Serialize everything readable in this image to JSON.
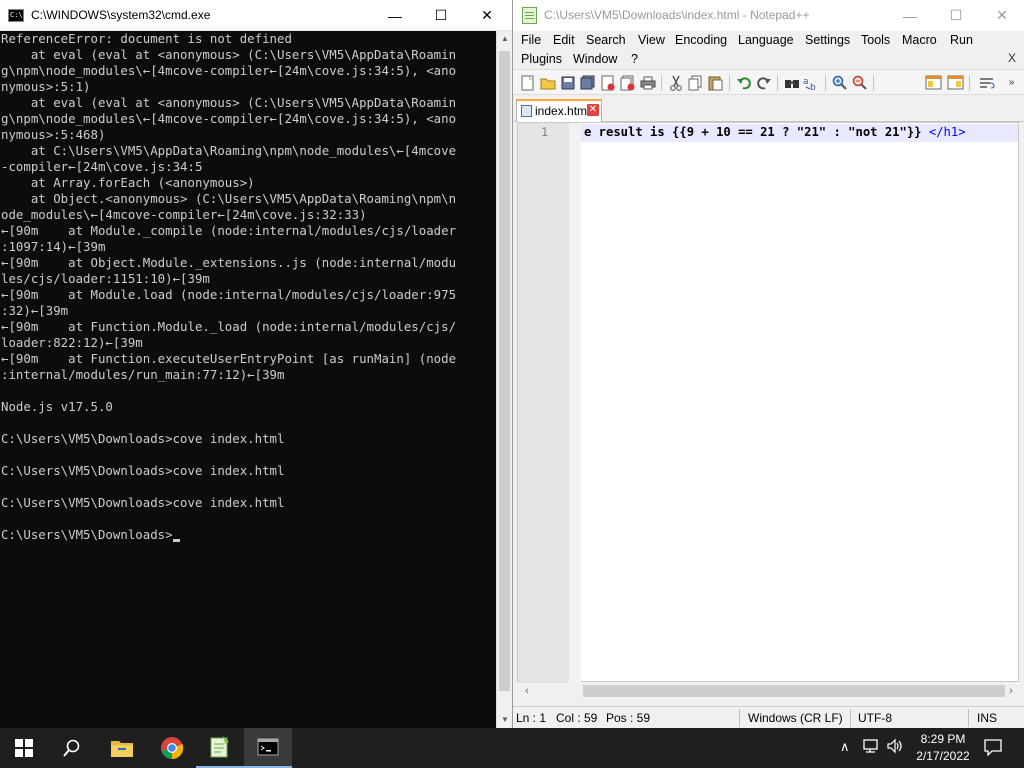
{
  "cmd": {
    "title": "C:\\WINDOWS\\system32\\cmd.exe",
    "icon_text": "C:\\",
    "buttons": {
      "minimize": "—",
      "maximize": "☐",
      "close": "✕"
    },
    "lines": [
      "ReferenceError: document is not defined",
      "    at eval (eval at <anonymous> (C:\\Users\\VM5\\AppData\\Roamin",
      "g\\npm\\node_modules\\←[4mcove-compiler←[24m\\cove.js:34:5), <ano",
      "nymous>:5:1)",
      "    at eval (eval at <anonymous> (C:\\Users\\VM5\\AppData\\Roamin",
      "g\\npm\\node_modules\\←[4mcove-compiler←[24m\\cove.js:34:5), <ano",
      "nymous>:5:468)",
      "    at C:\\Users\\VM5\\AppData\\Roaming\\npm\\node_modules\\←[4mcove",
      "-compiler←[24m\\cove.js:34:5",
      "    at Array.forEach (<anonymous>)",
      "    at Object.<anonymous> (C:\\Users\\VM5\\AppData\\Roaming\\npm\\n",
      "ode_modules\\←[4mcove-compiler←[24m\\cove.js:32:33)",
      "←[90m    at Module._compile (node:internal/modules/cjs/loader",
      ":1097:14)←[39m",
      "←[90m    at Object.Module._extensions..js (node:internal/modu",
      "les/cjs/loader:1151:10)←[39m",
      "←[90m    at Module.load (node:internal/modules/cjs/loader:975",
      ":32)←[39m",
      "←[90m    at Function.Module._load (node:internal/modules/cjs/",
      "loader:822:12)←[39m",
      "←[90m    at Function.executeUserEntryPoint [as runMain] (node",
      ":internal/modules/run_main:77:12)←[39m",
      "",
      "Node.js v17.5.0",
      "",
      "C:\\Users\\VM5\\Downloads>cove index.html",
      "",
      "C:\\Users\\VM5\\Downloads>cove index.html",
      "",
      "C:\\Users\\VM5\\Downloads>cove index.html",
      "",
      "C:\\Users\\VM5\\Downloads>"
    ]
  },
  "npp": {
    "title": "C:\\Users\\VM5\\Downloads\\index.html - Notepad++",
    "menu": {
      "file": "File",
      "edit": "Edit",
      "search": "Search",
      "view": "View",
      "encoding": "Encoding",
      "language": "Language",
      "settings": "Settings",
      "tools": "Tools",
      "macro": "Macro",
      "run": "Run",
      "plugins": "Plugins",
      "window": "Window",
      "help": "?",
      "close_doc": "X"
    },
    "tab": {
      "label": "index.html",
      "close": "✕"
    },
    "line_number": "1",
    "code": {
      "text": "e result is {{9 + 10 == 21 ? \"21\" : \"not 21\"}} ",
      "tag": "</h1>"
    },
    "status": {
      "line": "Ln : 1",
      "col": "Col : 59",
      "pos": "Pos : 59",
      "eol": "Windows (CR LF)",
      "encoding": "UTF-8",
      "mode": "INS"
    }
  },
  "taskbar": {
    "time": "8:29 PM",
    "date": "2/17/2022",
    "apps": [
      "start-icon",
      "search-icon",
      "file-explorer-icon",
      "chrome-icon",
      "notepad-plus-plus-icon",
      "cmd-icon"
    ]
  },
  "colors": {
    "console_bg": "#0c0c0c",
    "console_text": "#cccccc",
    "tag_blue": "#0000ff",
    "tab_accent": "#f9a73e",
    "taskbar_bg": "#1f1f1f"
  }
}
